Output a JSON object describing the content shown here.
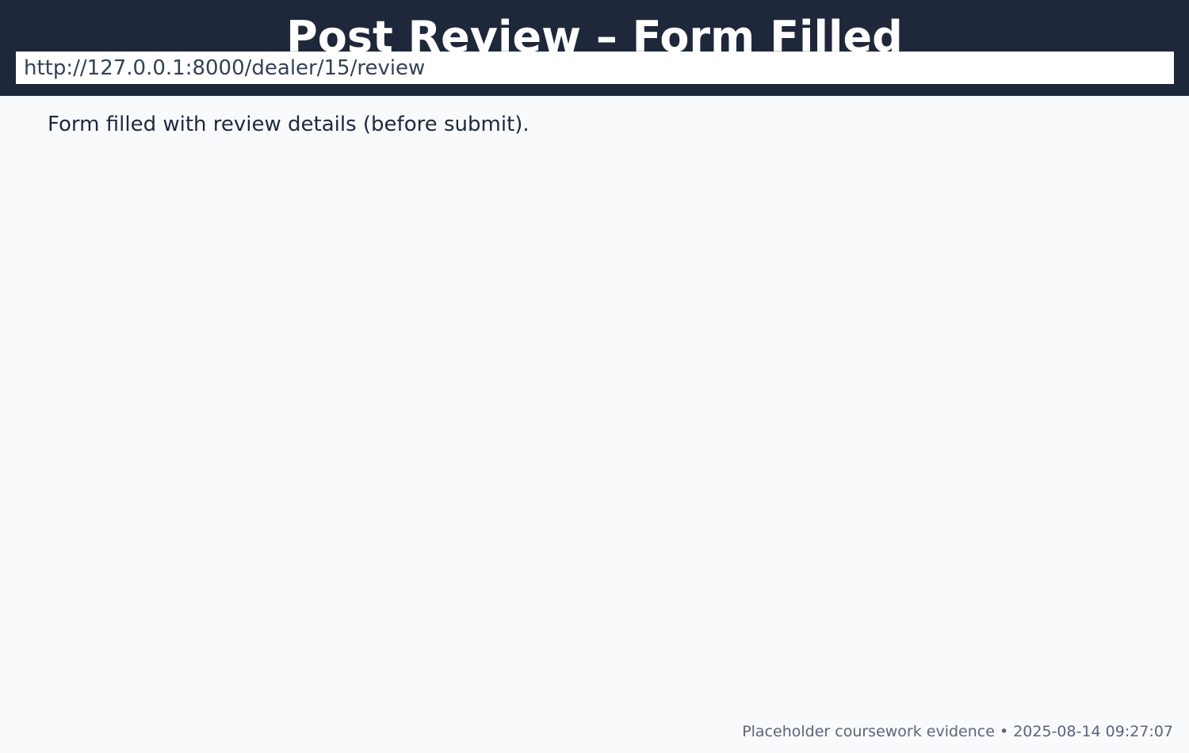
{
  "header": {
    "title": "Post Review – Form Filled",
    "background_color": "#1f273b"
  },
  "address_bar": {
    "url": "http://127.0.0.1:8000/dealer/15/review"
  },
  "main": {
    "caption": "Form filled with review details (before submit)."
  },
  "footer": {
    "note": "Placeholder coursework evidence • 2025-08-14 09:27:07"
  }
}
